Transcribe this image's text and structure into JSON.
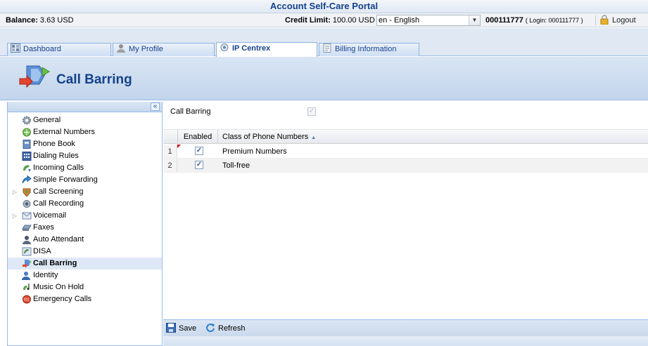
{
  "portal": {
    "title": "Account Self-Care Portal"
  },
  "infobar": {
    "balance_label": "Balance:",
    "balance_value": "3.63 USD",
    "credit_label": "Credit Limit:",
    "credit_value": "100.00 USD",
    "language": "en - English",
    "account_id": "000111777",
    "login_text": "( Login: 000111777 )",
    "logout_label": "Logout"
  },
  "tabs": [
    {
      "label": "Dashboard",
      "icon": "dashboard-icon"
    },
    {
      "label": "My Profile",
      "icon": "user-icon"
    },
    {
      "label": "IP Centrex",
      "icon": "ip-centrex-icon"
    },
    {
      "label": "Billing Information",
      "icon": "billing-icon"
    }
  ],
  "header": {
    "title": "Call Barring",
    "icon": "call-barring-icon"
  },
  "sidebar": {
    "items": [
      {
        "label": "General",
        "icon": "gear-icon"
      },
      {
        "label": "External Numbers",
        "icon": "external-numbers-icon"
      },
      {
        "label": "Phone Book",
        "icon": "phone-book-icon"
      },
      {
        "label": "Dialing Rules",
        "icon": "dialing-rules-icon"
      },
      {
        "label": "Incoming Calls",
        "icon": "incoming-calls-icon"
      },
      {
        "label": "Simple Forwarding",
        "icon": "forwarding-icon"
      },
      {
        "label": "Call Screening",
        "icon": "call-screening-icon"
      },
      {
        "label": "Call Recording",
        "icon": "call-recording-icon"
      },
      {
        "label": "Voicemail",
        "icon": "voicemail-icon"
      },
      {
        "label": "Faxes",
        "icon": "fax-icon"
      },
      {
        "label": "Auto Attendant",
        "icon": "auto-attendant-icon"
      },
      {
        "label": "DISA",
        "icon": "disa-icon"
      },
      {
        "label": "Call Barring",
        "icon": "call-barring-icon"
      },
      {
        "label": "Identity",
        "icon": "identity-icon"
      },
      {
        "label": "Music On Hold",
        "icon": "music-icon"
      },
      {
        "label": "Emergency Calls",
        "icon": "emergency-icon"
      }
    ]
  },
  "main": {
    "call_barring_label": "Call Barring",
    "call_barring_checked": true,
    "grid": {
      "col_enabled": "Enabled",
      "col_class": "Class of Phone Numbers",
      "rows": [
        {
          "num": "1",
          "enabled": true,
          "class": "Premium Numbers"
        },
        {
          "num": "2",
          "enabled": true,
          "class": "Toll-free"
        }
      ]
    },
    "toolbar": {
      "save_label": "Save",
      "refresh_label": "Refresh"
    }
  }
}
